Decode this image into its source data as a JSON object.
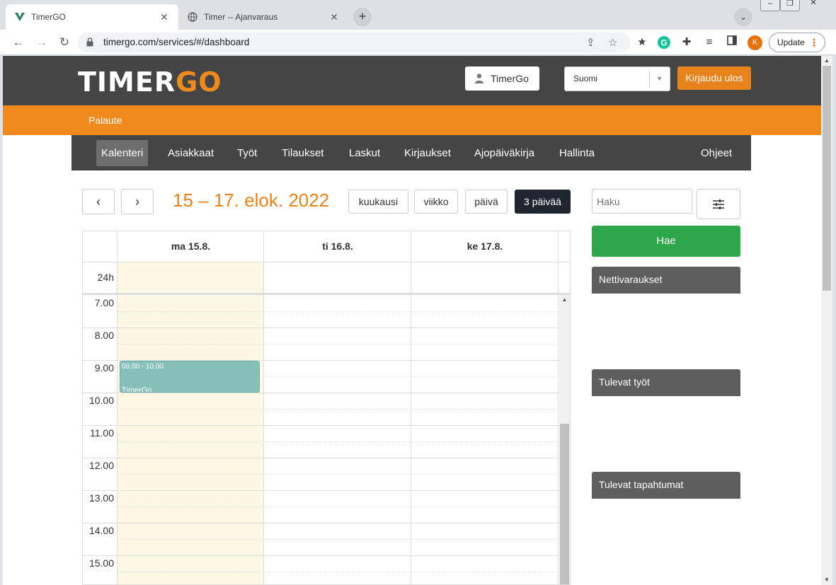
{
  "browser": {
    "tabs": [
      {
        "title": "TimerGO",
        "active": true
      },
      {
        "title": "Timer -- Ajanvaraus",
        "active": false
      }
    ],
    "url": "timergo.com/services/#/dashboard",
    "profile_initial": "K",
    "update_label": "Update",
    "accent_color": "#e8710a"
  },
  "header": {
    "logo_part1": "TIMER",
    "logo_part2": "GO",
    "user_label": "TimerGo",
    "language": "Suomi",
    "logout_label": "Kirjaudu ulos",
    "brand_color": "#f08a1c"
  },
  "subnav": {
    "feedback_label": "Palaute"
  },
  "nav": {
    "items": [
      {
        "label": "Kalenteri",
        "active": true
      },
      {
        "label": "Asiakkaat"
      },
      {
        "label": "Työt"
      },
      {
        "label": "Tilaukset"
      },
      {
        "label": "Laskut"
      },
      {
        "label": "Kirjaukset"
      },
      {
        "label": "Ajopäiväkirja"
      },
      {
        "label": "Hallinta"
      },
      {
        "label": "Ohjeet"
      }
    ]
  },
  "calendar": {
    "date_range": "15 – 17. elok. 2022",
    "views": [
      "kuukausi",
      "viikko",
      "päivä",
      "3 päivää"
    ],
    "active_view": "3 päivää",
    "days": [
      "ma 15.8.",
      "ti 16.8.",
      "ke 17.8."
    ],
    "allday_label": "24h",
    "hours": [
      "7.00",
      "8.00",
      "9.00",
      "10.00",
      "11.00",
      "12.00",
      "13.00",
      "14.00",
      "15.00"
    ],
    "event": {
      "time": "09.00 - 10.00",
      "title": "TimerGo",
      "color": "#85c1b8"
    }
  },
  "sidebar": {
    "search_placeholder": "Haku",
    "search_button": "Hae",
    "panels": [
      "Nettivaraukset",
      "Tulevat työt",
      "Tulevat tapahtumat"
    ]
  }
}
